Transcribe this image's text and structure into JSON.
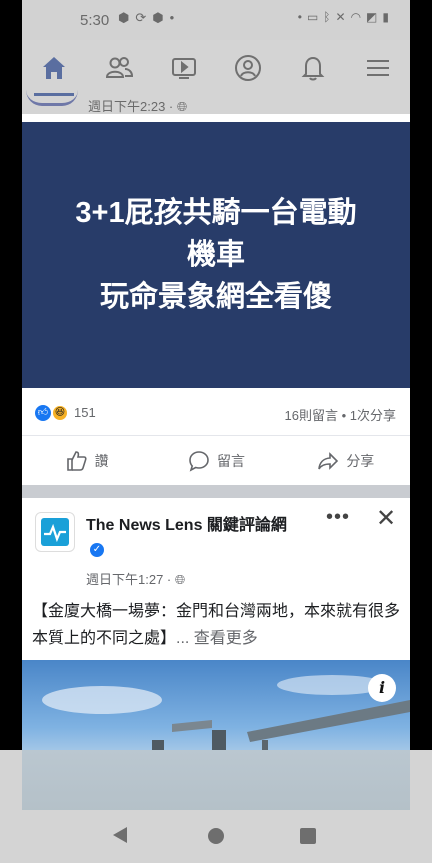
{
  "status_bar": {
    "time": "5:30",
    "left_icons": [
      "android-icon",
      "sync-icon",
      "android-icon",
      "dot-icon"
    ],
    "right_icons": [
      "dot-icon",
      "cast-icon",
      "bluetooth-icon",
      "mute-icon",
      "wifi-icon",
      "no-sim-icon",
      "battery-icon"
    ]
  },
  "nav_tabs": [
    {
      "name": "home",
      "icon": "home-icon",
      "active": true
    },
    {
      "name": "friends",
      "icon": "friends-icon",
      "active": false
    },
    {
      "name": "watch",
      "icon": "video-icon",
      "active": false
    },
    {
      "name": "profile",
      "icon": "profile-icon",
      "active": false
    },
    {
      "name": "notifications",
      "icon": "bell-icon",
      "active": false
    },
    {
      "name": "menu",
      "icon": "hamburger-icon",
      "active": false
    }
  ],
  "post1": {
    "time": "週日下午2:23 · ",
    "banner_lines": [
      "3+1屁孩共騎一台電動",
      "機車",
      "玩命景象網全看傻"
    ],
    "reaction_count": "151",
    "comments_shares": "16則留言 • 1次分享",
    "actions": {
      "like": "讚",
      "comment": "留言",
      "share": "分享"
    }
  },
  "post2": {
    "page_name": "The News Lens 關鍵評論網",
    "time": "週日下午1:27 · ",
    "body": "【金廈大橋一場夢：金門和台灣兩地，本來就有很多本質上的不同之處】",
    "see_more": "... 查看更多",
    "more_dots": "•••",
    "close": "✕",
    "info_badge": "i"
  },
  "colors": {
    "banner_bg": "#283c69",
    "facebook_blue": "#1877f2",
    "overlay_gray": "#d4d4d4"
  }
}
